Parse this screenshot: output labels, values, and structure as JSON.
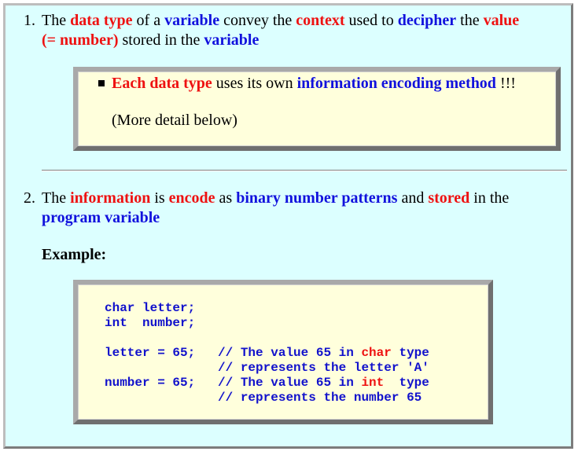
{
  "item1": {
    "number": "1.",
    "line1": [
      {
        "t": "The ",
        "c": "plain"
      },
      {
        "t": "data type",
        "c": "red"
      },
      {
        "t": " of a ",
        "c": "plain"
      },
      {
        "t": "variable",
        "c": "blue"
      },
      {
        "t": " convey the ",
        "c": "plain"
      },
      {
        "t": "context",
        "c": "red"
      },
      {
        "t": " used to ",
        "c": "plain"
      },
      {
        "t": "decipher",
        "c": "blue"
      },
      {
        "t": " the ",
        "c": "plain"
      },
      {
        "t": "value",
        "c": "red"
      }
    ],
    "line2": [
      {
        "t": "(= number)",
        "c": "red"
      },
      {
        "t": " stored in the ",
        "c": "plain"
      },
      {
        "t": "variable",
        "c": "blue"
      }
    ]
  },
  "box1": {
    "bullet_line": [
      {
        "t": "Each data type",
        "c": "red"
      },
      {
        "t": " uses its own ",
        "c": "plain"
      },
      {
        "t": "information encoding method",
        "c": "blue"
      },
      {
        "t": " !!!",
        "c": "plain"
      }
    ],
    "more": "(More detail below)"
  },
  "item2": {
    "number": "2.",
    "line1": [
      {
        "t": "The ",
        "c": "plain"
      },
      {
        "t": "information",
        "c": "red"
      },
      {
        "t": " is ",
        "c": "plain"
      },
      {
        "t": "encode",
        "c": "red"
      },
      {
        "t": " as ",
        "c": "plain"
      },
      {
        "t": "binary number patterns",
        "c": "blue"
      },
      {
        "t": " and ",
        "c": "plain"
      },
      {
        "t": "stored",
        "c": "red"
      },
      {
        "t": " in the",
        "c": "plain"
      }
    ],
    "line2": [
      {
        "t": "program variable",
        "c": "blue"
      }
    ],
    "example_label": "Example:"
  },
  "code": {
    "lines": [
      [
        {
          "t": "char letter;",
          "c": ""
        }
      ],
      [
        {
          "t": "int  number;",
          "c": ""
        }
      ],
      [
        {
          "t": "",
          "c": ""
        }
      ],
      [
        {
          "t": "letter = 65;   // The value 65 in ",
          "c": ""
        },
        {
          "t": "char",
          "c": "kw-red"
        },
        {
          "t": " type",
          "c": ""
        }
      ],
      [
        {
          "t": "               // represents the letter 'A'",
          "c": ""
        }
      ],
      [
        {
          "t": "number = 65;   // The value 65 in ",
          "c": ""
        },
        {
          "t": "int",
          "c": "kw-red"
        },
        {
          "t": "  type",
          "c": ""
        }
      ],
      [
        {
          "t": "               // represents the number 65",
          "c": ""
        }
      ]
    ]
  }
}
